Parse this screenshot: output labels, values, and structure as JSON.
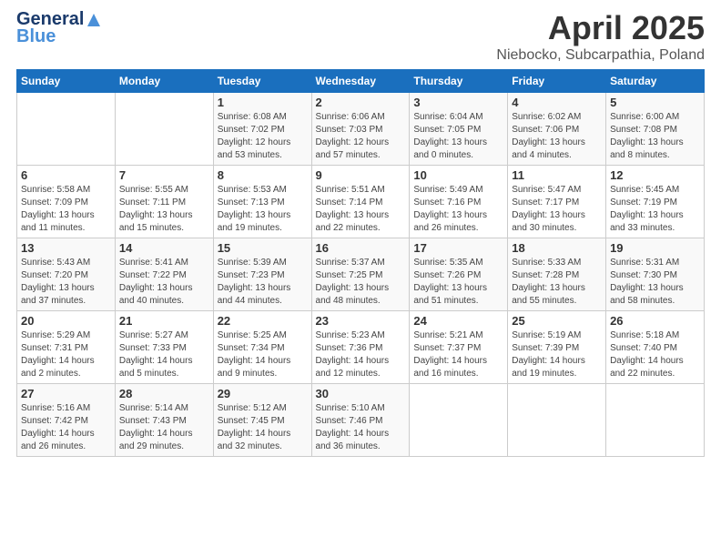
{
  "logo": {
    "line1": "General",
    "line2": "Blue"
  },
  "header": {
    "title": "April 2025",
    "subtitle": "Niebocko, Subcarpathia, Poland"
  },
  "days_of_week": [
    "Sunday",
    "Monday",
    "Tuesday",
    "Wednesday",
    "Thursday",
    "Friday",
    "Saturday"
  ],
  "weeks": [
    [
      {
        "day": "",
        "info": ""
      },
      {
        "day": "",
        "info": ""
      },
      {
        "day": "1",
        "info": "Sunrise: 6:08 AM\nSunset: 7:02 PM\nDaylight: 12 hours and 53 minutes."
      },
      {
        "day": "2",
        "info": "Sunrise: 6:06 AM\nSunset: 7:03 PM\nDaylight: 12 hours and 57 minutes."
      },
      {
        "day": "3",
        "info": "Sunrise: 6:04 AM\nSunset: 7:05 PM\nDaylight: 13 hours and 0 minutes."
      },
      {
        "day": "4",
        "info": "Sunrise: 6:02 AM\nSunset: 7:06 PM\nDaylight: 13 hours and 4 minutes."
      },
      {
        "day": "5",
        "info": "Sunrise: 6:00 AM\nSunset: 7:08 PM\nDaylight: 13 hours and 8 minutes."
      }
    ],
    [
      {
        "day": "6",
        "info": "Sunrise: 5:58 AM\nSunset: 7:09 PM\nDaylight: 13 hours and 11 minutes."
      },
      {
        "day": "7",
        "info": "Sunrise: 5:55 AM\nSunset: 7:11 PM\nDaylight: 13 hours and 15 minutes."
      },
      {
        "day": "8",
        "info": "Sunrise: 5:53 AM\nSunset: 7:13 PM\nDaylight: 13 hours and 19 minutes."
      },
      {
        "day": "9",
        "info": "Sunrise: 5:51 AM\nSunset: 7:14 PM\nDaylight: 13 hours and 22 minutes."
      },
      {
        "day": "10",
        "info": "Sunrise: 5:49 AM\nSunset: 7:16 PM\nDaylight: 13 hours and 26 minutes."
      },
      {
        "day": "11",
        "info": "Sunrise: 5:47 AM\nSunset: 7:17 PM\nDaylight: 13 hours and 30 minutes."
      },
      {
        "day": "12",
        "info": "Sunrise: 5:45 AM\nSunset: 7:19 PM\nDaylight: 13 hours and 33 minutes."
      }
    ],
    [
      {
        "day": "13",
        "info": "Sunrise: 5:43 AM\nSunset: 7:20 PM\nDaylight: 13 hours and 37 minutes."
      },
      {
        "day": "14",
        "info": "Sunrise: 5:41 AM\nSunset: 7:22 PM\nDaylight: 13 hours and 40 minutes."
      },
      {
        "day": "15",
        "info": "Sunrise: 5:39 AM\nSunset: 7:23 PM\nDaylight: 13 hours and 44 minutes."
      },
      {
        "day": "16",
        "info": "Sunrise: 5:37 AM\nSunset: 7:25 PM\nDaylight: 13 hours and 48 minutes."
      },
      {
        "day": "17",
        "info": "Sunrise: 5:35 AM\nSunset: 7:26 PM\nDaylight: 13 hours and 51 minutes."
      },
      {
        "day": "18",
        "info": "Sunrise: 5:33 AM\nSunset: 7:28 PM\nDaylight: 13 hours and 55 minutes."
      },
      {
        "day": "19",
        "info": "Sunrise: 5:31 AM\nSunset: 7:30 PM\nDaylight: 13 hours and 58 minutes."
      }
    ],
    [
      {
        "day": "20",
        "info": "Sunrise: 5:29 AM\nSunset: 7:31 PM\nDaylight: 14 hours and 2 minutes."
      },
      {
        "day": "21",
        "info": "Sunrise: 5:27 AM\nSunset: 7:33 PM\nDaylight: 14 hours and 5 minutes."
      },
      {
        "day": "22",
        "info": "Sunrise: 5:25 AM\nSunset: 7:34 PM\nDaylight: 14 hours and 9 minutes."
      },
      {
        "day": "23",
        "info": "Sunrise: 5:23 AM\nSunset: 7:36 PM\nDaylight: 14 hours and 12 minutes."
      },
      {
        "day": "24",
        "info": "Sunrise: 5:21 AM\nSunset: 7:37 PM\nDaylight: 14 hours and 16 minutes."
      },
      {
        "day": "25",
        "info": "Sunrise: 5:19 AM\nSunset: 7:39 PM\nDaylight: 14 hours and 19 minutes."
      },
      {
        "day": "26",
        "info": "Sunrise: 5:18 AM\nSunset: 7:40 PM\nDaylight: 14 hours and 22 minutes."
      }
    ],
    [
      {
        "day": "27",
        "info": "Sunrise: 5:16 AM\nSunset: 7:42 PM\nDaylight: 14 hours and 26 minutes."
      },
      {
        "day": "28",
        "info": "Sunrise: 5:14 AM\nSunset: 7:43 PM\nDaylight: 14 hours and 29 minutes."
      },
      {
        "day": "29",
        "info": "Sunrise: 5:12 AM\nSunset: 7:45 PM\nDaylight: 14 hours and 32 minutes."
      },
      {
        "day": "30",
        "info": "Sunrise: 5:10 AM\nSunset: 7:46 PM\nDaylight: 14 hours and 36 minutes."
      },
      {
        "day": "",
        "info": ""
      },
      {
        "day": "",
        "info": ""
      },
      {
        "day": "",
        "info": ""
      }
    ]
  ]
}
